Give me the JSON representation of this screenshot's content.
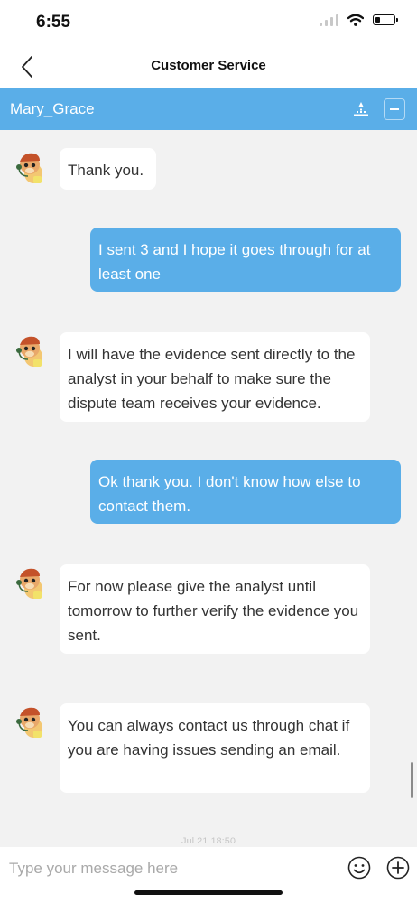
{
  "status_bar": {
    "time": "6:55"
  },
  "nav": {
    "title": "Customer Service"
  },
  "agent_bar": {
    "name": "Mary_Grace"
  },
  "messages": [
    {
      "sender": "agent",
      "text": "Thank you."
    },
    {
      "sender": "user",
      "text": "I sent 3 and I hope it goes through for at least one"
    },
    {
      "sender": "agent",
      "text": "I will have the evidence sent directly to the analyst in your behalf to make sure the dispute team receives your evidence."
    },
    {
      "sender": "user",
      "text": "Ok thank you. I don't know how else to contact them."
    },
    {
      "sender": "agent",
      "text": "For now please give the analyst until tomorrow to further verify the evidence you sent."
    },
    {
      "sender": "agent",
      "text": "You can always contact us through chat if you are having issues sending an email."
    }
  ],
  "timestamp": "Jul 21 18:50",
  "input": {
    "placeholder": "Type your message here",
    "value": ""
  },
  "colors": {
    "accent": "#5aaee8",
    "chat_background": "#f2f2f2",
    "agent_bubble": "#ffffff"
  },
  "icons": {
    "back": "chevron-left-icon",
    "rate": "rating-icon",
    "minimize": "minimize-icon",
    "emoji": "emoji-icon",
    "plus": "add-icon",
    "avatar": "agent-avatar"
  }
}
